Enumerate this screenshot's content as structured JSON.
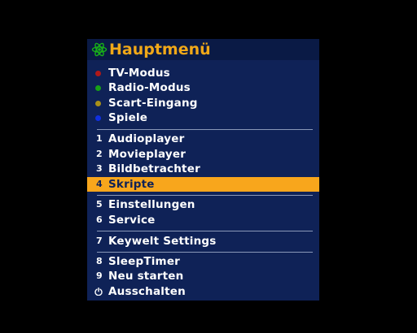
{
  "header": {
    "title": "Hauptmenü",
    "icon": "atom-icon"
  },
  "colors": {
    "red": "#b01818",
    "green": "#18a018",
    "yellow": "#a89018",
    "blue": "#1030e0",
    "highlight": "#f8a61c",
    "title": "#f0a818"
  },
  "group1": [
    {
      "label": "TV-Modus",
      "dot": "red"
    },
    {
      "label": "Radio-Modus",
      "dot": "green"
    },
    {
      "label": "Scart-Eingang",
      "dot": "yellow"
    },
    {
      "label": "Spiele",
      "dot": "blue"
    }
  ],
  "group2": [
    {
      "num": "1",
      "label": "Audioplayer"
    },
    {
      "num": "2",
      "label": "Movieplayer"
    },
    {
      "num": "3",
      "label": "Bildbetrachter"
    },
    {
      "num": "4",
      "label": "Skripte",
      "selected": true
    }
  ],
  "group3": [
    {
      "num": "5",
      "label": "Einstellungen"
    },
    {
      "num": "6",
      "label": "Service"
    }
  ],
  "group4": [
    {
      "num": "7",
      "label": "Keywelt Settings"
    }
  ],
  "group5": [
    {
      "num": "8",
      "label": "SleepTimer"
    },
    {
      "num": "9",
      "label": "Neu starten"
    },
    {
      "label": "Ausschalten",
      "icon": "power-icon"
    }
  ]
}
